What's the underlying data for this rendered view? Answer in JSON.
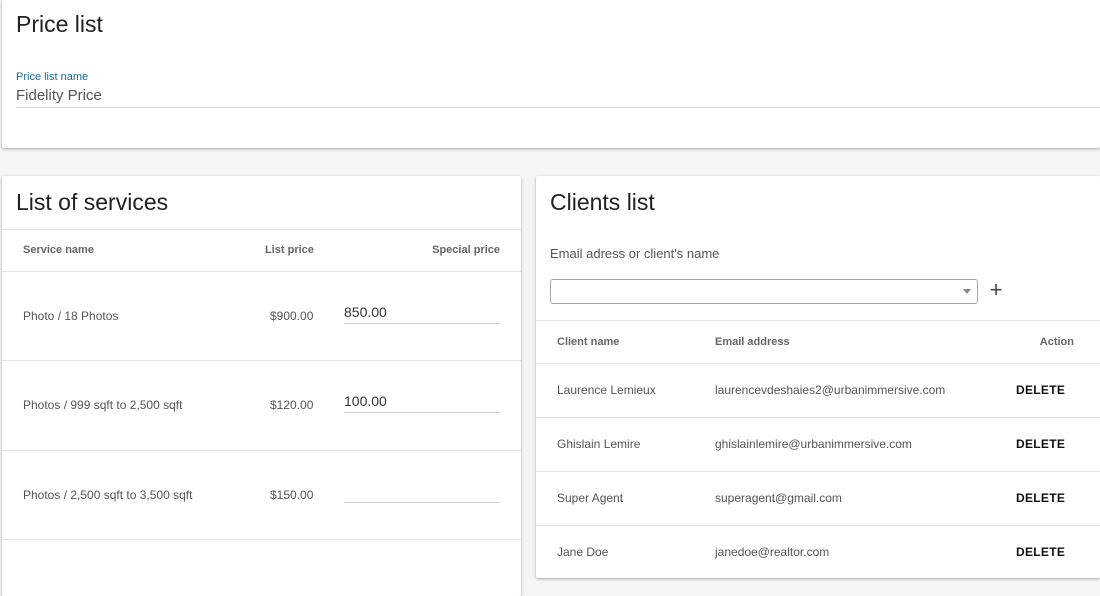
{
  "page": {
    "title": "Price list",
    "name_label": "Price list name",
    "name_value": "Fidelity Price"
  },
  "services": {
    "title": "List of services",
    "headers": {
      "name": "Service name",
      "list_price": "List price",
      "special_price": "Special price"
    },
    "rows": [
      {
        "name": "Photo / 18 Photos",
        "list_price": "$900.00",
        "special_price": "850.00"
      },
      {
        "name": "Photos / 999 sqft to 2,500 sqft",
        "list_price": "$120.00",
        "special_price": "100.00"
      },
      {
        "name": "Photos / 2,500 sqft to 3,500 sqft",
        "list_price": "$150.00",
        "special_price": ""
      }
    ]
  },
  "clients": {
    "title": "Clients list",
    "search_hint": "Email adress or client's name",
    "add_icon": "plus-icon",
    "headers": {
      "name": "Client name",
      "email": "Email address",
      "action": "Action"
    },
    "delete_label": "DELETE",
    "rows": [
      {
        "name": "Laurence Lemieux",
        "email": "laurencevdeshaies2@urbanimmersive.com"
      },
      {
        "name": "Ghislain Lemire",
        "email": "ghislainlemire@urbanimmersive.com"
      },
      {
        "name": "Super Agent",
        "email": "superagent@gmail.com"
      },
      {
        "name": "Jane Doe",
        "email": "janedoe@realtor.com"
      }
    ]
  },
  "colors": {
    "label_accent": "#1a6a9a",
    "background": "#f5f5f5"
  }
}
